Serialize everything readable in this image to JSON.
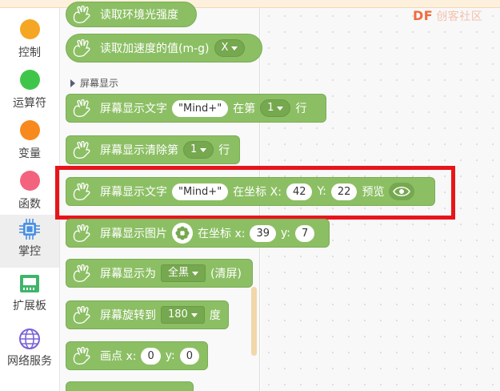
{
  "sidebar": {
    "items": [
      {
        "label": "控制",
        "color": "#f5a623"
      },
      {
        "label": "运算符",
        "color": "#3fc64a"
      },
      {
        "label": "变量",
        "color": "#f7891f"
      },
      {
        "label": "函数",
        "color": "#f3637d"
      },
      {
        "label": "掌控",
        "icon": "chip-icon",
        "active": true
      },
      {
        "label": "扩展板",
        "icon": "board-icon"
      },
      {
        "label": "网络服务",
        "icon": "globe-icon"
      }
    ]
  },
  "brand": {
    "text": "DF",
    "faint": "创客社区"
  },
  "palette": {
    "section_title": "屏幕显示",
    "blocks": {
      "read_light": "读取环境光强度",
      "read_accel": {
        "label": "读取加速度的值(m-g)",
        "axis": "X"
      },
      "show_text": {
        "label": "屏幕显示文字",
        "text": "\"Mind+\"",
        "row_prefix": "在第",
        "row": "1",
        "row_suffix": "行"
      },
      "clear_line": {
        "label": "屏幕显示清除第",
        "row": "1",
        "suffix": "行"
      },
      "show_text_xy": {
        "label": "屏幕显示文字",
        "text": "\"Mind+\"",
        "coord_label": "在坐标 X:",
        "x": "42",
        "y_label": "Y:",
        "y": "22",
        "preview": "预览"
      },
      "show_image": {
        "label": "屏幕显示图片",
        "coord_label": "在坐标 x:",
        "x": "39",
        "y_label": "y:",
        "y": "7"
      },
      "fill_screen": {
        "label": "屏幕显示为",
        "mode": "全黑",
        "suffix": "(清屏)"
      },
      "rotate": {
        "label": "屏幕旋转到",
        "angle": "180",
        "suffix": "度"
      },
      "point": {
        "label": "画点 x:",
        "x": "0",
        "y_label": "y:",
        "y": "0"
      }
    }
  },
  "colors": {
    "block": "#8cbf64",
    "highlight": "#e8141b"
  }
}
